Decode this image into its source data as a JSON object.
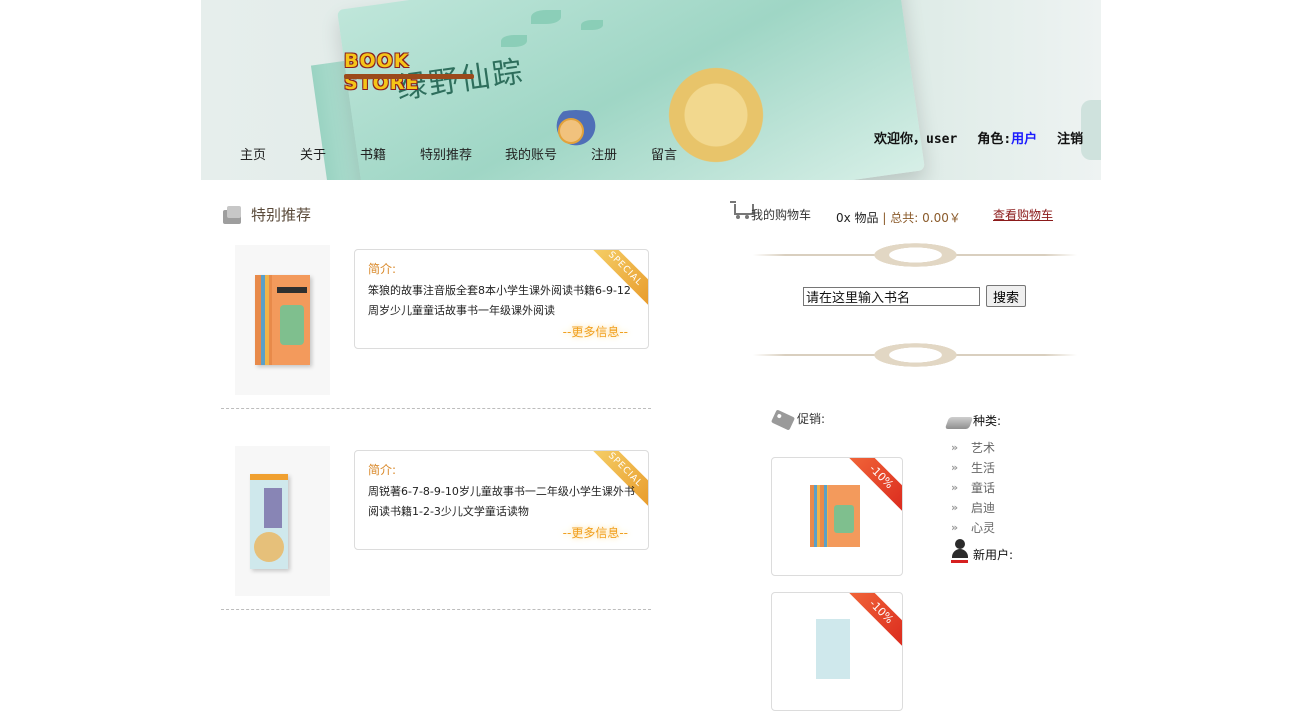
{
  "header": {
    "logo_text": "BOOK STORE",
    "banner_book_title": "绿野仙踪",
    "nav": [
      "主页",
      "关于",
      "书籍",
      "特别推荐",
      "我的账号",
      "注册",
      "留言"
    ],
    "welcome": "欢迎你，",
    "username": "user",
    "role_label": "角色:",
    "role_value": "用户",
    "logout": "注销"
  },
  "featured": {
    "title": "特别推荐",
    "intro_label": "简介:",
    "more_label": "--更多信息--",
    "ribbon": "SPECIAL",
    "items": [
      {
        "desc": "笨狼的故事注音版全套8本小学生课外阅读书籍6-9-12周岁少儿童童话故事书一年级课外阅读"
      },
      {
        "desc": "周锐著6-7-8-9-10岁儿童故事书一二年级小学生课外书阅读书籍1-2-3少儿文学童话读物"
      }
    ]
  },
  "cart": {
    "label": "我的购物车",
    "count": "0x 物品",
    "separator": "|",
    "total": "总共: 0.00￥",
    "view_link": "查看购物车"
  },
  "search": {
    "value": "请在这里输入书名",
    "button": "搜索"
  },
  "promotions": {
    "title": "促销:",
    "badge": "-10%"
  },
  "categories": {
    "title": "种类:",
    "chevron": "»",
    "items": [
      "艺术",
      "生活",
      "童话",
      "启迪",
      "心灵"
    ],
    "new_users_label": "新用户:"
  },
  "icons": {
    "featured": "box-icon",
    "cart": "shopping-cart-icon",
    "promo": "price-tag-icon",
    "categories": "category-icon",
    "new_users": "user-icon"
  },
  "colors": {
    "accent_orange": "#f0a020",
    "role_blue": "#1a1aff",
    "cart_link": "#8b1a1a",
    "promo_red": "#d9261c"
  }
}
